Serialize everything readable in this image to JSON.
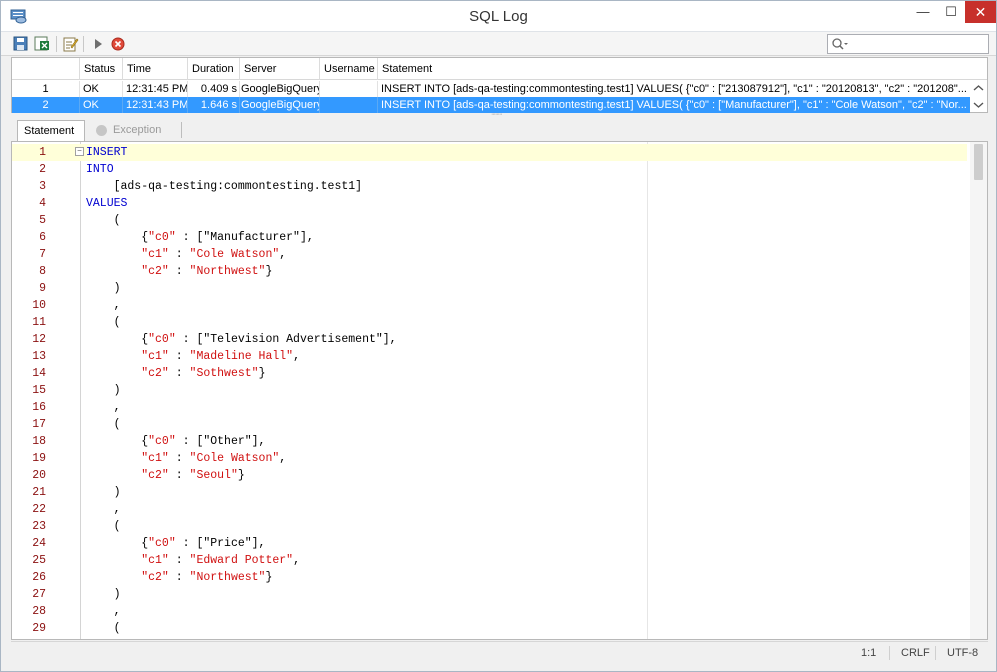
{
  "window": {
    "title": "SQL Log",
    "minimize": "—",
    "maximize": "☐",
    "close": "✕"
  },
  "toolbar": {
    "search_placeholder": ""
  },
  "grid": {
    "columns": [
      "",
      "Status",
      "Time",
      "Duration",
      "Server",
      "Username",
      "Statement"
    ],
    "rows": [
      {
        "num": "1",
        "status": "OK",
        "time": "12:31:45 PM",
        "duration": "0.409 s",
        "server": "GoogleBigQuery",
        "username": "",
        "statement": "INSERT INTO [ads-qa-testing:commontesting.test1]  VALUES( {\"c0\" : [\"213087912\"], \"c1\" : \"20120813\", \"c2\" : \"201208\"..."
      },
      {
        "num": "2",
        "status": "OK",
        "time": "12:31:43 PM",
        "duration": "1.646 s",
        "server": "GoogleBigQuery",
        "username": "",
        "statement": "INSERT INTO [ads-qa-testing:commontesting.test1]  VALUES( {\"c0\" : [\"Manufacturer\"], \"c1\" : \"Cole Watson\", \"c2\" : \"Nor..."
      }
    ]
  },
  "tabs": {
    "statement": "Statement",
    "exception": "Exception"
  },
  "editor": {
    "lines": [
      [
        {
          "t": "INSERT",
          "c": "kw"
        }
      ],
      [
        {
          "t": "INTO",
          "c": "kw"
        }
      ],
      [
        {
          "t": "    [ads-qa-testing:commontesting.test1]",
          "c": ""
        }
      ],
      [
        {
          "t": "VALUES",
          "c": "kw"
        }
      ],
      [
        {
          "t": "    (",
          "c": ""
        }
      ],
      [
        {
          "t": "        {",
          "c": ""
        },
        {
          "t": "\"c0\"",
          "c": "str"
        },
        {
          "t": " : [\"Manufacturer\"],",
          "c": ""
        }
      ],
      [
        {
          "t": "        ",
          "c": ""
        },
        {
          "t": "\"c1\"",
          "c": "str"
        },
        {
          "t": " : ",
          "c": ""
        },
        {
          "t": "\"Cole Watson\"",
          "c": "str"
        },
        {
          "t": ",",
          "c": ""
        }
      ],
      [
        {
          "t": "        ",
          "c": ""
        },
        {
          "t": "\"c2\"",
          "c": "str"
        },
        {
          "t": " : ",
          "c": ""
        },
        {
          "t": "\"Northwest\"",
          "c": "str"
        },
        {
          "t": "}",
          "c": ""
        }
      ],
      [
        {
          "t": "    )",
          "c": ""
        }
      ],
      [
        {
          "t": "    ,",
          "c": ""
        }
      ],
      [
        {
          "t": "    (",
          "c": ""
        }
      ],
      [
        {
          "t": "        {",
          "c": ""
        },
        {
          "t": "\"c0\"",
          "c": "str"
        },
        {
          "t": " : [\"Television Advertisement\"],",
          "c": ""
        }
      ],
      [
        {
          "t": "        ",
          "c": ""
        },
        {
          "t": "\"c1\"",
          "c": "str"
        },
        {
          "t": " : ",
          "c": ""
        },
        {
          "t": "\"Madeline Hall\"",
          "c": "str"
        },
        {
          "t": ",",
          "c": ""
        }
      ],
      [
        {
          "t": "        ",
          "c": ""
        },
        {
          "t": "\"c2\"",
          "c": "str"
        },
        {
          "t": " : ",
          "c": ""
        },
        {
          "t": "\"Sothwest\"",
          "c": "str"
        },
        {
          "t": "}",
          "c": ""
        }
      ],
      [
        {
          "t": "    )",
          "c": ""
        }
      ],
      [
        {
          "t": "    ,",
          "c": ""
        }
      ],
      [
        {
          "t": "    (",
          "c": ""
        }
      ],
      [
        {
          "t": "        {",
          "c": ""
        },
        {
          "t": "\"c0\"",
          "c": "str"
        },
        {
          "t": " : [\"Other\"],",
          "c": ""
        }
      ],
      [
        {
          "t": "        ",
          "c": ""
        },
        {
          "t": "\"c1\"",
          "c": "str"
        },
        {
          "t": " : ",
          "c": ""
        },
        {
          "t": "\"Cole Watson\"",
          "c": "str"
        },
        {
          "t": ",",
          "c": ""
        }
      ],
      [
        {
          "t": "        ",
          "c": ""
        },
        {
          "t": "\"c2\"",
          "c": "str"
        },
        {
          "t": " : ",
          "c": ""
        },
        {
          "t": "\"Seoul\"",
          "c": "str"
        },
        {
          "t": "}",
          "c": ""
        }
      ],
      [
        {
          "t": "    )",
          "c": ""
        }
      ],
      [
        {
          "t": "    ,",
          "c": ""
        }
      ],
      [
        {
          "t": "    (",
          "c": ""
        }
      ],
      [
        {
          "t": "        {",
          "c": ""
        },
        {
          "t": "\"c0\"",
          "c": "str"
        },
        {
          "t": " : [\"Price\"],",
          "c": ""
        }
      ],
      [
        {
          "t": "        ",
          "c": ""
        },
        {
          "t": "\"c1\"",
          "c": "str"
        },
        {
          "t": " : ",
          "c": ""
        },
        {
          "t": "\"Edward Potter\"",
          "c": "str"
        },
        {
          "t": ",",
          "c": ""
        }
      ],
      [
        {
          "t": "        ",
          "c": ""
        },
        {
          "t": "\"c2\"",
          "c": "str"
        },
        {
          "t": " : ",
          "c": ""
        },
        {
          "t": "\"Northwest\"",
          "c": "str"
        },
        {
          "t": "}",
          "c": ""
        }
      ],
      [
        {
          "t": "    )",
          "c": ""
        }
      ],
      [
        {
          "t": "    ,",
          "c": ""
        }
      ],
      [
        {
          "t": "    (",
          "c": ""
        }
      ]
    ]
  },
  "statusbar": {
    "position": "1:1",
    "line_ending": "CRLF",
    "encoding": "UTF-8"
  },
  "colors": {
    "selection": "#3399ff",
    "keyword": "#0000d0",
    "string": "#d01010",
    "line_number": "#8b1010",
    "close_button": "#c7302b"
  }
}
